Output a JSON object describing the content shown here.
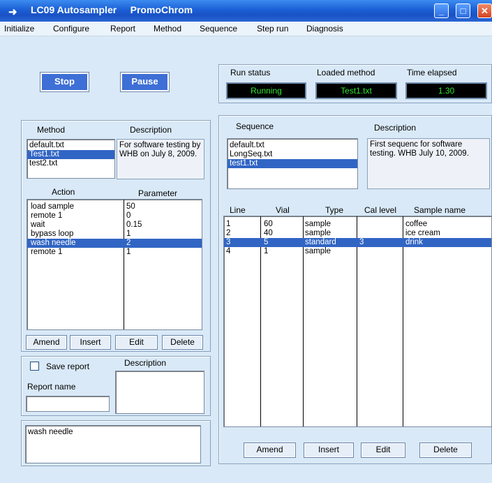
{
  "window": {
    "title": "LC09 Autosampler     PromoChrom",
    "minimize": "_",
    "maximize": "□",
    "close": "✕"
  },
  "menu": [
    "Initialize",
    "Configure",
    "Report",
    "Method",
    "Sequence",
    "Step run",
    "Diagnosis"
  ],
  "controls": {
    "stop": "Stop",
    "pause": "Pause"
  },
  "run_status": {
    "label": "Run status",
    "value": "Running"
  },
  "loaded_method": {
    "label": "Loaded method",
    "value": "Test1.txt"
  },
  "time_elapsed": {
    "label": "Time elapsed",
    "value": "1.30"
  },
  "method": {
    "header": "Method",
    "description_header": "Description",
    "files": [
      "default.txt",
      "Test1.txt",
      "test2.txt"
    ],
    "selected": 1,
    "description": "For software testing by WHB on July 8, 2009."
  },
  "actions": {
    "action_header": "Action",
    "parameter_header": "Parameter",
    "rows": [
      {
        "action": "load sample",
        "parameter": "50"
      },
      {
        "action": "remote 1",
        "parameter": "0"
      },
      {
        "action": "wait",
        "parameter": "0.15"
      },
      {
        "action": "bypass loop",
        "parameter": "1"
      },
      {
        "action": "wash needle",
        "parameter": "2"
      },
      {
        "action": "remote 1",
        "parameter": "1"
      }
    ],
    "selected": 4,
    "buttons": [
      "Amend",
      "Insert",
      "Edit",
      "Delete"
    ]
  },
  "report": {
    "save_label": "Save report",
    "checked": false,
    "description_header": "Description",
    "name_label": "Report name",
    "name_value": ""
  },
  "note": "wash needle",
  "sequence": {
    "header": "Sequence",
    "description_header": "Description",
    "files": [
      "default.txt",
      "LongSeq.txt",
      "test1.txt"
    ],
    "selected": 2,
    "description": "First sequenc for software testing. WHB July 10, 2009."
  },
  "sequence_table": {
    "headers": [
      "Line",
      "Vial",
      "Type",
      "Cal level",
      "Sample name"
    ],
    "rows": [
      [
        "1",
        "60",
        "sample",
        "",
        "coffee"
      ],
      [
        "2",
        "40",
        "sample",
        "",
        "ice cream"
      ],
      [
        "3",
        "5",
        "standard",
        "3",
        "drink"
      ],
      [
        "4",
        "1",
        "sample",
        "",
        ""
      ]
    ],
    "selected": 2,
    "buttons": [
      "Amend",
      "Insert",
      "Edit",
      "Delete"
    ]
  }
}
